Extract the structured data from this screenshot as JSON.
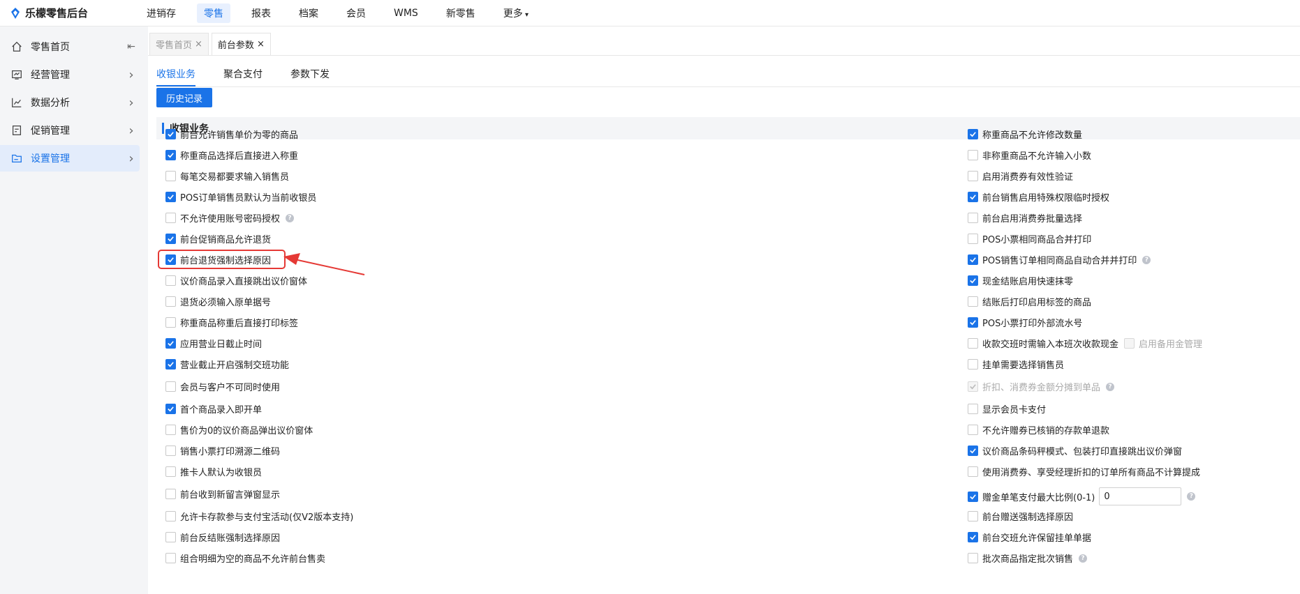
{
  "app": {
    "title": "乐檬零售后台"
  },
  "topnav": [
    {
      "label": "进销存",
      "active": false
    },
    {
      "label": "零售",
      "active": true
    },
    {
      "label": "报表",
      "active": false
    },
    {
      "label": "档案",
      "active": false
    },
    {
      "label": "会员",
      "active": false
    },
    {
      "label": "WMS",
      "active": false
    },
    {
      "label": "新零售",
      "active": false
    },
    {
      "label": "更多",
      "active": false
    }
  ],
  "sidebar": [
    {
      "label": "零售首页",
      "icon": "home-icon",
      "right": "collapse",
      "active": false
    },
    {
      "label": "经营管理",
      "icon": "chart-box-icon",
      "right": "arrow",
      "active": false
    },
    {
      "label": "数据分析",
      "icon": "line-chart-icon",
      "right": "arrow",
      "active": false
    },
    {
      "label": "促销管理",
      "icon": "promo-icon",
      "right": "arrow",
      "active": false
    },
    {
      "label": "设置管理",
      "icon": "folder-icon",
      "right": "arrow",
      "active": true
    }
  ],
  "page_tabs": [
    {
      "label": "零售首页",
      "active": false
    },
    {
      "label": "前台参数",
      "active": true
    }
  ],
  "sub_tabs": [
    {
      "label": "收银业务",
      "active": true
    },
    {
      "label": "聚合支付",
      "active": false
    },
    {
      "label": "参数下发",
      "active": false
    }
  ],
  "history_button": "历史记录",
  "section_title": "收银业务",
  "left_options": [
    {
      "label": "前台允许销售单价为零的商品",
      "checked": true
    },
    {
      "label": "称重商品选择后直接进入称重",
      "checked": true
    },
    {
      "label": "每笔交易都要求输入销售员",
      "checked": false
    },
    {
      "label": "POS订单销售员默认为当前收银员",
      "checked": true
    },
    {
      "label": "不允许使用账号密码授权",
      "checked": false,
      "help": true
    },
    {
      "label": "前台促销商品允许退货",
      "checked": true
    },
    {
      "label": "前台退货强制选择原因",
      "checked": true
    },
    {
      "label": "议价商品录入直接跳出议价窗体",
      "checked": false
    },
    {
      "label": "退货必须输入原单据号",
      "checked": false
    },
    {
      "label": "称重商品称重后直接打印标签",
      "checked": false
    },
    {
      "label": "应用营业日截止时间",
      "checked": true
    },
    {
      "label": "营业截止开启强制交班功能",
      "checked": true
    },
    {
      "label": "会员与客户不可同时使用",
      "checked": false
    },
    {
      "label": "首个商品录入即开单",
      "checked": true
    },
    {
      "label": "售价为0的议价商品弹出议价窗体",
      "checked": false
    },
    {
      "label": "销售小票打印溯源二维码",
      "checked": false
    },
    {
      "label": "推卡人默认为收银员",
      "checked": false
    },
    {
      "label": "前台收到新留言弹窗显示",
      "checked": false
    },
    {
      "label": "允许卡存款参与支付宝活动(仅V2版本支持)",
      "checked": false
    },
    {
      "label": "前台反结账强制选择原因",
      "checked": false
    },
    {
      "label": "组合明细为空的商品不允许前台售卖",
      "checked": false
    }
  ],
  "right_options": [
    {
      "label": "称重商品不允许修改数量",
      "checked": true
    },
    {
      "label": "非称重商品不允许输入小数",
      "checked": false
    },
    {
      "label": "启用消费券有效性验证",
      "checked": false
    },
    {
      "label": "前台销售启用特殊权限临时授权",
      "checked": true
    },
    {
      "label": "前台启用消费券批量选择",
      "checked": false
    },
    {
      "label": "POS小票相同商品合并打印",
      "checked": false
    },
    {
      "label": "POS销售订单相同商品自动合并并打印",
      "checked": true,
      "help": true
    },
    {
      "label": "现金结账启用快速抹零",
      "checked": true
    },
    {
      "label": "结账后打印启用标签的商品",
      "checked": false
    },
    {
      "label": "POS小票打印外部流水号",
      "checked": true
    },
    {
      "label": "收款交班时需输入本班次收款现金",
      "checked": false,
      "extra_label": "启用备用金管理"
    },
    {
      "label": "挂单需要选择销售员",
      "checked": false
    },
    {
      "label": "折扣、消费券金额分摊到单品",
      "checked": true,
      "disabled": true,
      "help": true
    },
    {
      "label": "显示会员卡支付",
      "checked": false
    },
    {
      "label": "不允许赠券已核销的存款单退款",
      "checked": false
    },
    {
      "label": "议价商品条码秤模式、包装打印直接跳出议价弹窗",
      "checked": true
    },
    {
      "label": "使用消费券、享受经理折扣的订单所有商品不计算提成",
      "checked": false
    },
    {
      "label": "赠金单笔支付最大比例(0-1)",
      "checked": true,
      "input_value": "0",
      "help": true
    },
    {
      "label": "前台赠送强制选择原因",
      "checked": false
    },
    {
      "label": "前台交班允许保留挂单单据",
      "checked": true
    },
    {
      "label": "批次商品指定批次销售",
      "checked": false,
      "help": true
    }
  ]
}
